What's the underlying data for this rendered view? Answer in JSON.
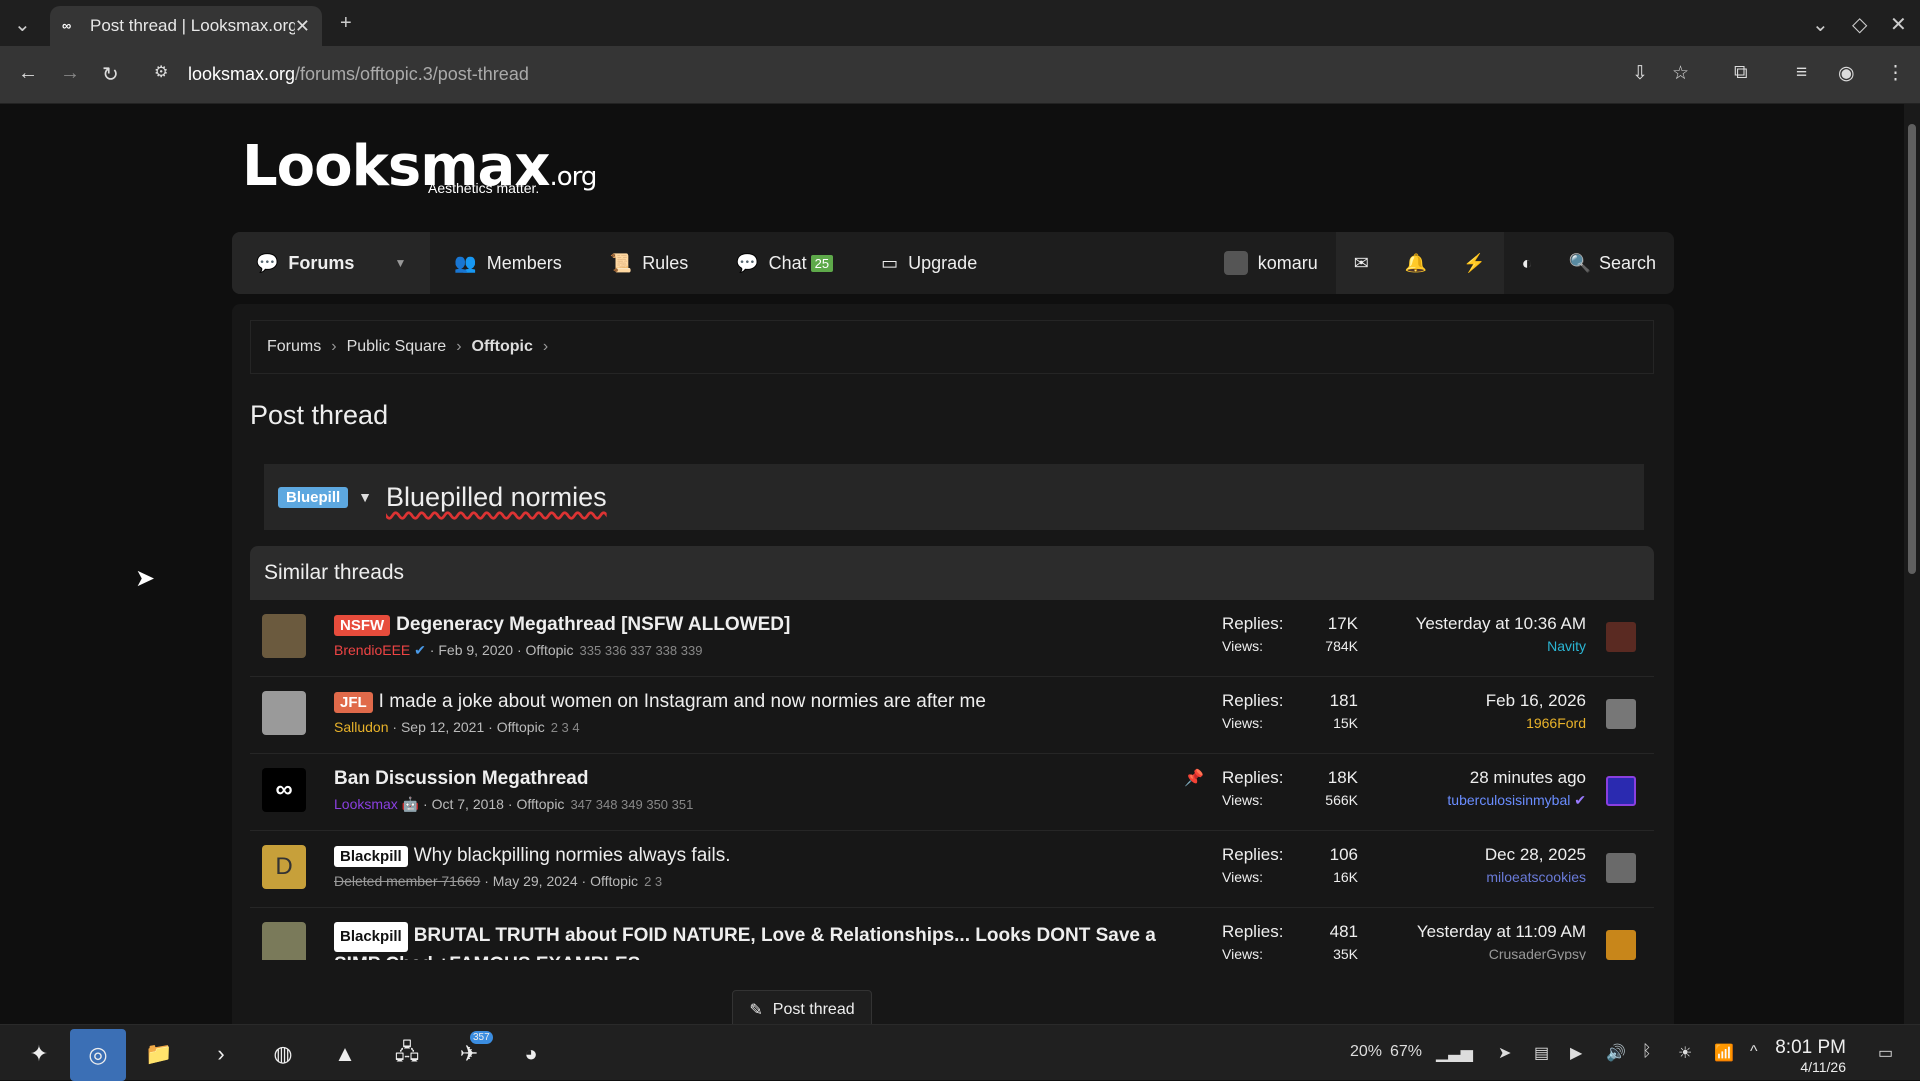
{
  "browser": {
    "tab_title": "Post thread | Looksmax.org",
    "url_host": "looksmax.org",
    "url_path": "/forums/offtopic.3/post-thread"
  },
  "site": {
    "logo": "Looksmax",
    "logo_suffix": ".org",
    "tagline": "Aesthetics matter."
  },
  "nav": {
    "forums": "Forums",
    "members": "Members",
    "rules": "Rules",
    "chat": "Chat",
    "chat_badge": "25",
    "upgrade": "Upgrade",
    "user": "komaru",
    "search": "Search"
  },
  "breadcrumb": {
    "items": [
      "Forums",
      "Public Square",
      "Offtopic"
    ]
  },
  "page": {
    "title": "Post thread",
    "prefix": "Bluepill",
    "thread_title": "Bluepilled normies",
    "similar_heading": "Similar threads",
    "post_button": "Post thread"
  },
  "threads": [
    {
      "label": "NSFW",
      "title": "Degeneracy Megathread [NSFW ALLOWED]",
      "author": "BrendioEEE",
      "date": "Feb 9, 2020",
      "forum": "Offtopic",
      "pages": "335 336 337 338 339",
      "replies": "17K",
      "views": "784K",
      "last_time": "Yesterday at 10:36 AM",
      "last_user": "Navity"
    },
    {
      "label": "JFL",
      "title": "I made a joke about women on Instagram and now normies are after me",
      "author": "Salludon",
      "date": "Sep 12, 2021",
      "forum": "Offtopic",
      "pages": "2 3 4",
      "replies": "181",
      "views": "15K",
      "last_time": "Feb 16, 2026",
      "last_user": "1966Ford"
    },
    {
      "label": "",
      "title": "Ban Discussion Megathread",
      "author": "Looksmax",
      "date": "Oct 7, 2018",
      "forum": "Offtopic",
      "pages": "347 348 349 350 351",
      "replies": "18K",
      "views": "566K",
      "last_time": "28 minutes ago",
      "last_user": "tuberculosisinmybal"
    },
    {
      "label": "Blackpill",
      "title": "Why blackpilling normies always fails.",
      "author": "Deleted member 71669",
      "date": "May 29, 2024",
      "forum": "Offtopic",
      "pages": "2 3",
      "replies": "106",
      "views": "16K",
      "last_time": "Dec 28, 2025",
      "last_user": "miloeatscookies"
    },
    {
      "label": "Blackpill",
      "title": "BRUTAL TRUTH about FOID NATURE, Love & Relationships... Looks DONT Save a SIMP Chad +FAMOUS EXAMPLES",
      "author": "",
      "date": "",
      "forum": "",
      "pages": "",
      "replies": "481",
      "views": "35K",
      "last_time": "Yesterday at 11:09 AM",
      "last_user": "CrusaderGypsy"
    }
  ],
  "stats_labels": {
    "replies": "Replies:",
    "views": "Views:"
  },
  "taskbar": {
    "battery1": "20%",
    "battery2": "67%",
    "telegram_badge": "357",
    "time": "8:01 PM",
    "date": "4/11/26"
  },
  "colors": {
    "nsfw": "#e74c3c",
    "jfl": "#e06a4a",
    "prefix": "#5da8e0",
    "chat_badge": "#5ea94a"
  }
}
